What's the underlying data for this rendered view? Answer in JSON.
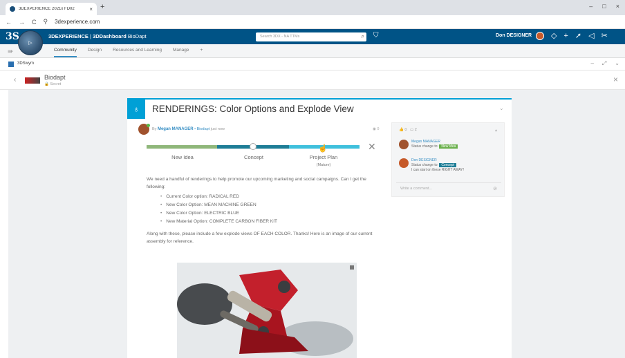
{
  "browser": {
    "tab_title": "3DEXPERIENCE 2021x FD02",
    "tab_close": "×",
    "new_tab": "+",
    "window_controls": [
      "–",
      "□",
      "×"
    ],
    "nav": [
      "←",
      "→",
      "C"
    ],
    "url": "3dexperience.com"
  },
  "header": {
    "brand_bold": "3DEXPERIENCE",
    "brand_sep": " | ",
    "brand_app": "3DDashboard",
    "brand_tenant": "BioDapt",
    "search_placeholder": "Search 3DX - NA TTMs",
    "user": "Don DESIGNER"
  },
  "subnav": {
    "tabs": [
      "Community",
      "Design",
      "Resources and Learning",
      "Manage"
    ],
    "add": "+"
  },
  "widget": {
    "name": "3DSwym"
  },
  "community": {
    "name": "Biodapt",
    "visibility": "Secret"
  },
  "post": {
    "title": "RENDERINGS: Color Options and Explode View",
    "by": "By",
    "author": "Megan MANAGER",
    "community": "• Biodapt",
    "time": "just now",
    "views": "0",
    "maturity": {
      "stages": [
        "New Idea",
        "Concept",
        "Project Plan"
      ],
      "sub": "(Mature)",
      "current": 0.5
    },
    "body_intro": "We need a handful of renderings to help promote our upcoming marketing and social campaigns.  Can I get the following:",
    "bullets": [
      "Current Color option: RADICAL RED",
      "New Color Option: MEAN MACHINE GREEN",
      "New Color Option: ELECTRIC BLUE",
      "New Material Option: COMPLETE CARBON FIBER KIT"
    ],
    "body_outro": "Along with these, please include a few explode views OF EACH COLOR.  Thanks!  Here is an image of our current assembly for reference."
  },
  "side": {
    "likes": "0",
    "comments": "2",
    "activity": [
      {
        "who": "Megan MANAGER",
        "text": "Status change to:",
        "tag": "New Idea",
        "tag_color": "#6ab04c",
        "note": ""
      },
      {
        "who": "Don DESIGNER",
        "text": "Status change to:",
        "tag": "Concept",
        "tag_color": "#1d7d96",
        "note": "I can start on these RIGHT AWAY!"
      }
    ],
    "comment_placeholder": "Write a comment..."
  }
}
